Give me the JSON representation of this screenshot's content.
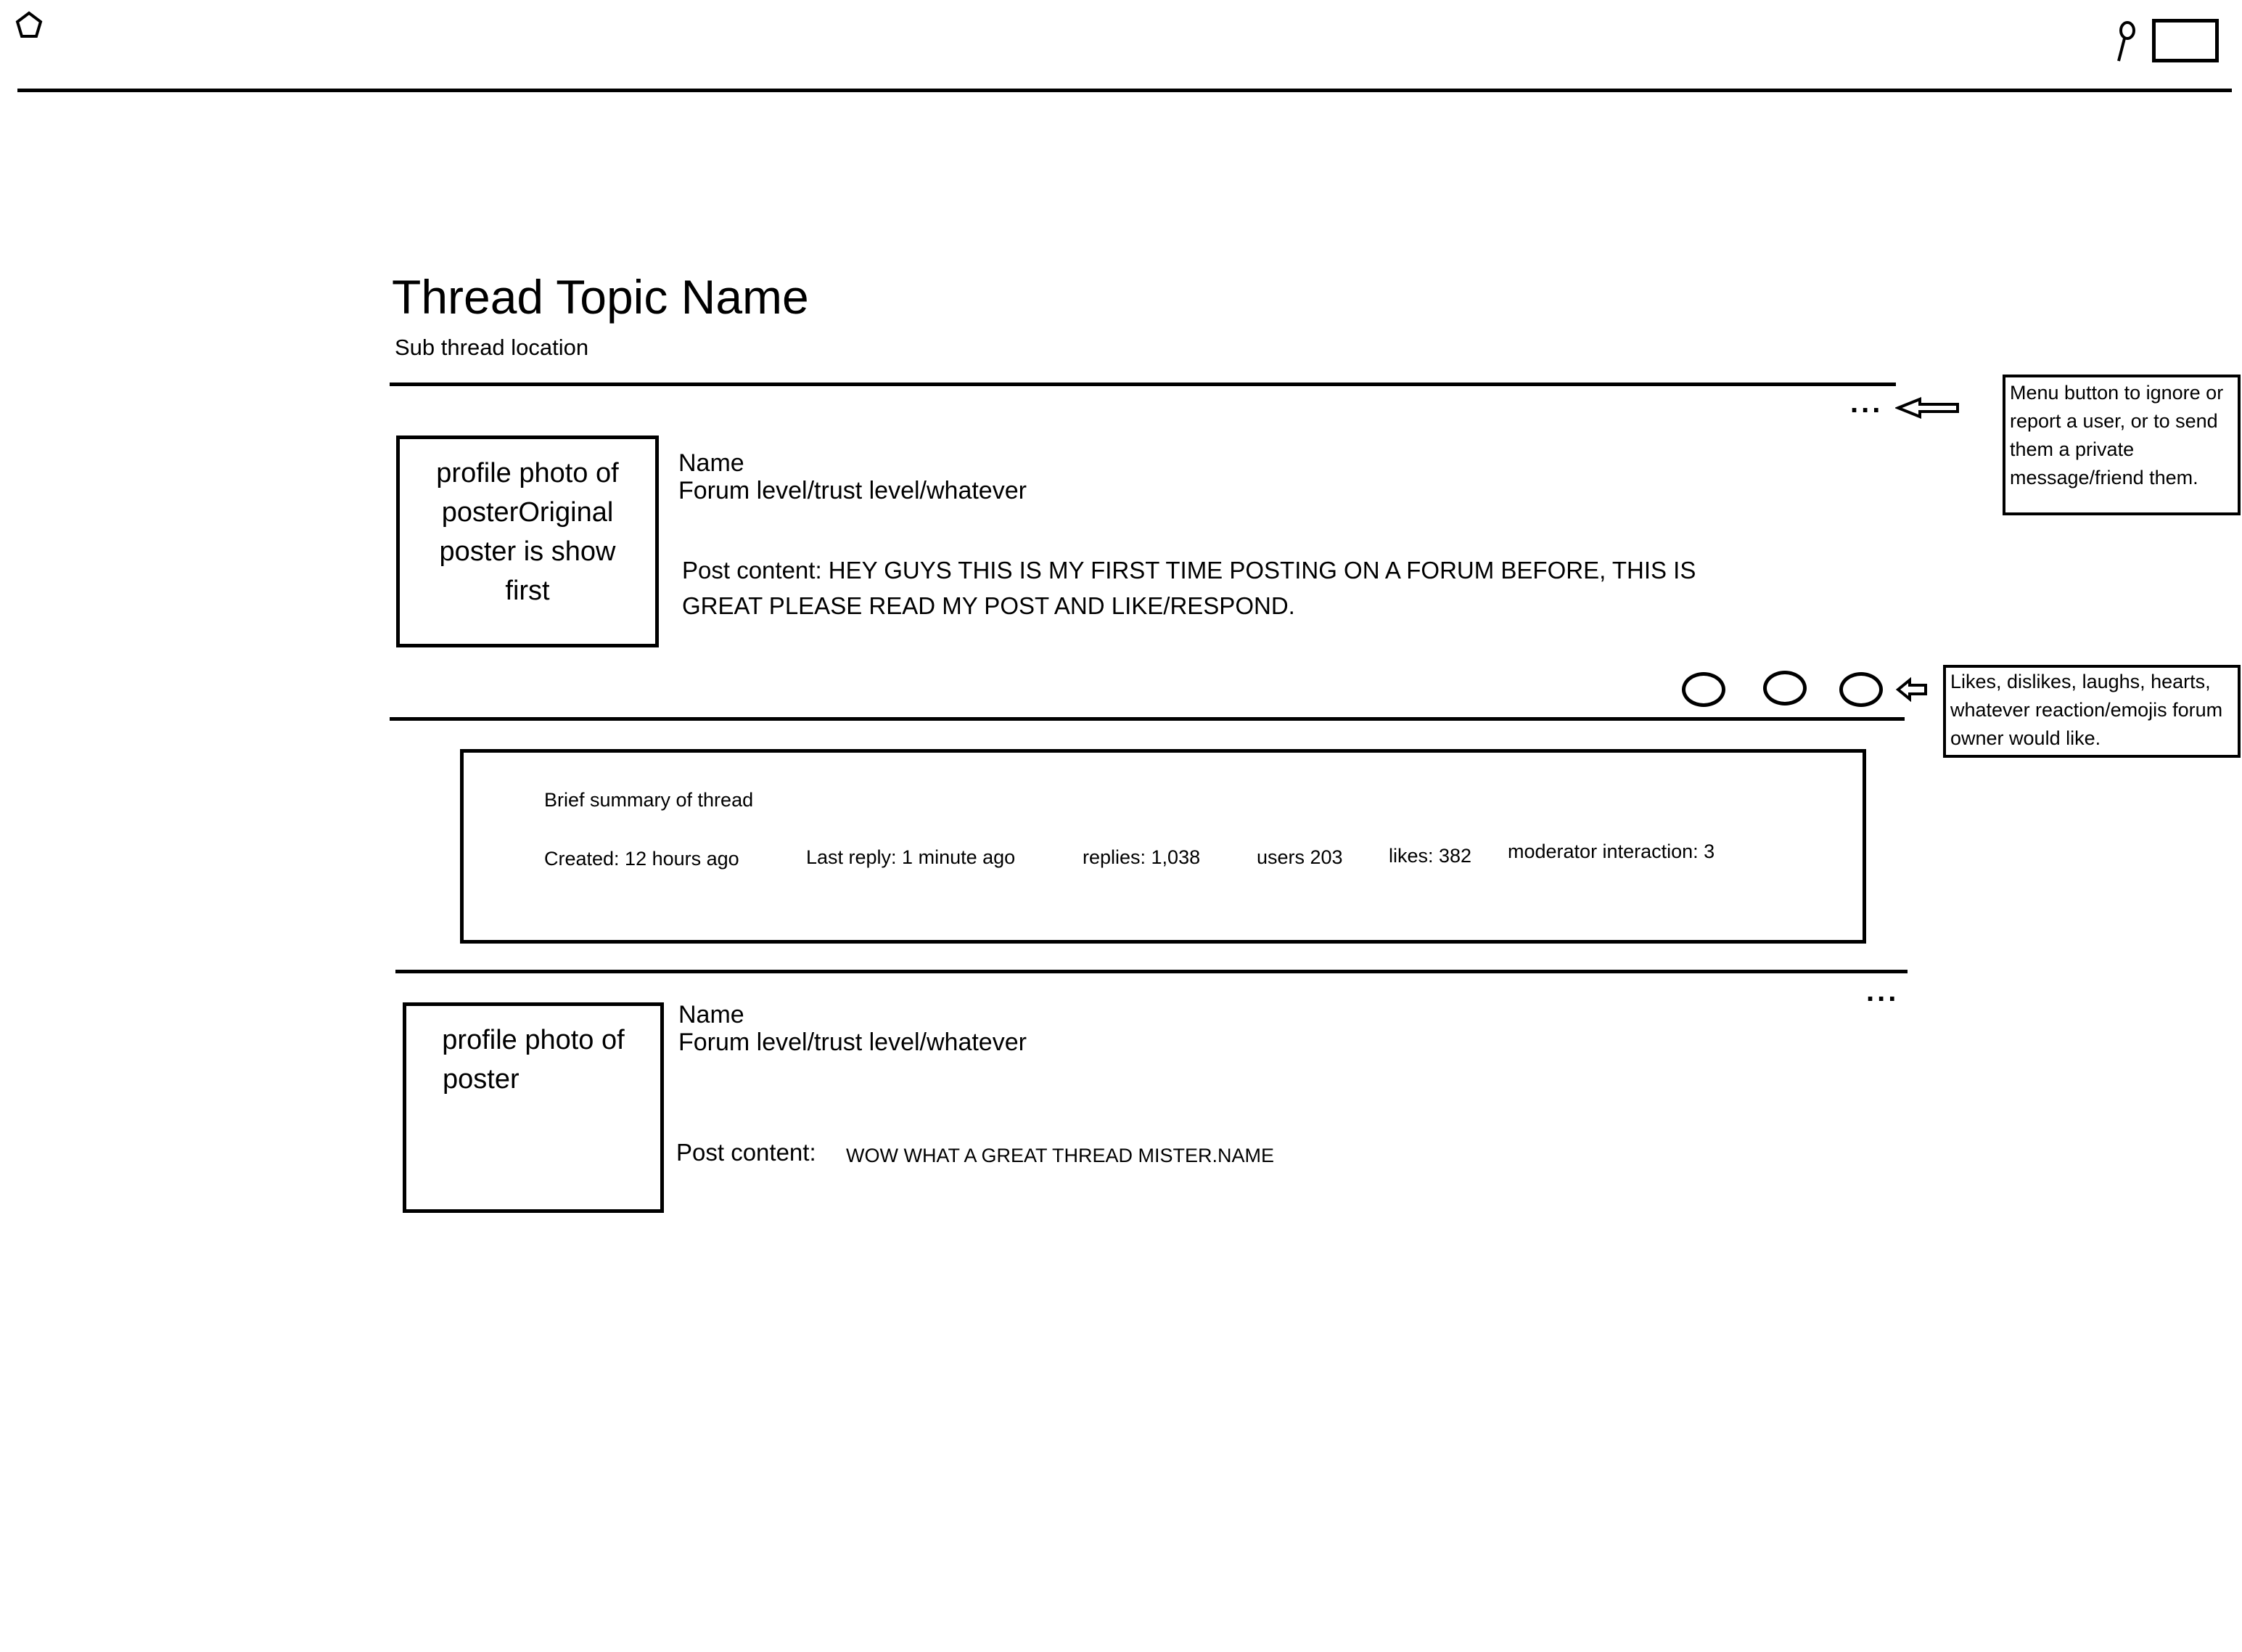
{
  "header": {
    "logo_icon": "pentagon-logo-icon",
    "search_icon": "search-icon",
    "account_icon": "rectangle-placeholder-icon"
  },
  "thread": {
    "title": "Thread Topic Name",
    "subtitle": "Sub thread location"
  },
  "posts": [
    {
      "photo_text_lines": [
        "profile photo of",
        "posterOriginal",
        "poster is show",
        "first"
      ],
      "name": "Name",
      "level": "Forum level/trust level/whatever",
      "content_line1": "Post content: HEY GUYS THIS IS MY FIRST TIME POSTING ON A FORUM BEFORE, THIS IS",
      "content_line2": "GREAT PLEASE READ MY POST AND LIKE/RESPOND.",
      "menu": "..."
    },
    {
      "photo_text_lines": [
        "profile photo of",
        "poster"
      ],
      "name": "Name",
      "level": "Forum level/trust level/whatever",
      "content_label": "Post content:",
      "content": "WOW WHAT A GREAT THREAD MISTER.NAME",
      "menu": "..."
    }
  ],
  "annotations": {
    "menu_note": "Menu button to ignore or report a user, or to send them a private message/friend them.",
    "reactions_note": "Likes, dislikes, laughs, hearts, whatever reaction/emojis forum owner would like."
  },
  "summary": {
    "heading": "Brief summary of thread",
    "created": "Created: 12 hours ago",
    "last_reply": "Last reply: 1 minute ago",
    "replies": "replies: 1,038",
    "users": "users 203",
    "likes": "likes: 382",
    "moderator": "moderator interaction: 3"
  }
}
